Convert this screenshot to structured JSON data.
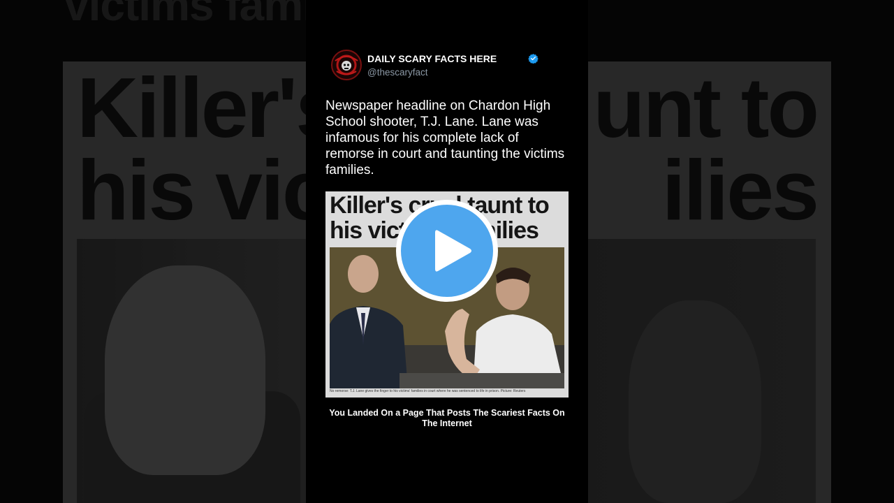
{
  "background": {
    "top_text": "victims famili",
    "headline_line1_left": "Killer's",
    "headline_line1_right": "unt to",
    "headline_line2_left": "his vict",
    "headline_line2_right": "ilies"
  },
  "post": {
    "account_name": "DAILY SCARY FACTS HERE",
    "handle": "@thescaryfact",
    "verified": true,
    "avatar_label": "THE SCARY FACT",
    "text": "Newspaper headline on Chardon High School shooter, T.J. Lane. Lane was infamous for his complete lack of remorse in court and taunting the victims families.",
    "media": {
      "headline_line1": "Killer's cruel taunt to",
      "headline_line2": "his victims' families",
      "caption": "No remorse: T.J. Lane gives the finger to his victims' families in court where he was sentenced to life in prison. Picture: Reuters"
    },
    "footer": "You Landed On a Page That Posts The Scariest Facts On The Internet"
  },
  "colors": {
    "accent_blue": "#4ea6ee",
    "verified_blue": "#1d9bf0",
    "handle_gray": "#8b98a5"
  },
  "icons": {
    "play": "play-icon",
    "verified": "verified-badge-icon"
  }
}
